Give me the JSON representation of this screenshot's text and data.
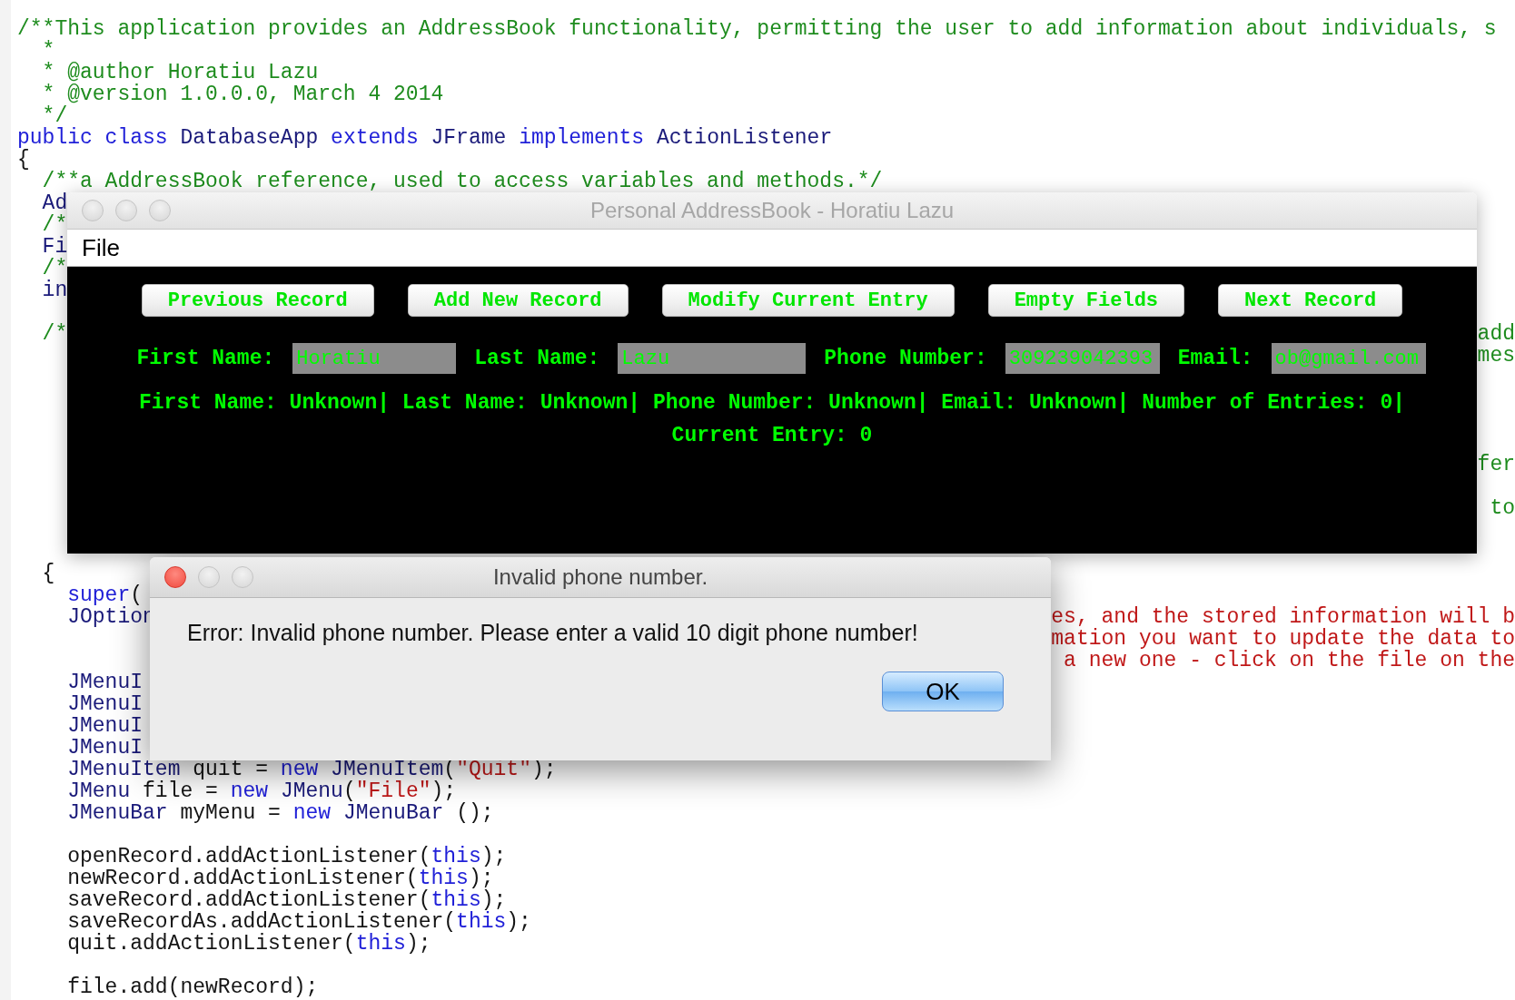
{
  "editor": {
    "lines": [
      {
        "left": [
          {
            "kind": "comment",
            "text": "/**This application provides an AddressBook functionality, permitting the user to add information about individuals, s"
          }
        ]
      },
      {
        "left": [
          {
            "kind": "comment",
            "text": "  *"
          }
        ]
      },
      {
        "left": [
          {
            "kind": "comment",
            "text": "  * @author Horatiu Lazu"
          }
        ]
      },
      {
        "left": [
          {
            "kind": "comment",
            "text": "  * @version 1.0.0.0, March 4 2014"
          }
        ]
      },
      {
        "left": [
          {
            "kind": "comment",
            "text": "  */"
          }
        ]
      },
      {
        "left": [
          {
            "kind": "keyword",
            "text": "public class "
          },
          {
            "kind": "type",
            "text": "DatabaseApp "
          },
          {
            "kind": "keyword",
            "text": "extends "
          },
          {
            "kind": "type",
            "text": "JFrame "
          },
          {
            "kind": "keyword",
            "text": "implements "
          },
          {
            "kind": "type",
            "text": "ActionListener"
          }
        ]
      },
      {
        "left": [
          {
            "kind": "plain",
            "text": "{"
          }
        ]
      },
      {
        "left": [
          {
            "kind": "comment",
            "text": "  /**a AddressBook reference, used to access variables and methods.*/"
          }
        ]
      },
      {
        "left": [
          {
            "kind": "type",
            "text": "  Ad"
          }
        ]
      },
      {
        "left": [
          {
            "kind": "comment",
            "text": "  /*"
          }
        ]
      },
      {
        "left": [
          {
            "kind": "type",
            "text": "  Fi"
          }
        ]
      },
      {
        "left": [
          {
            "kind": "comment",
            "text": "  /*"
          }
        ]
      },
      {
        "left": [
          {
            "kind": "type",
            "text": "  in"
          }
        ]
      },
      {
        "kind": "blank"
      },
      {
        "left": [
          {
            "kind": "comment",
            "text": "  /*"
          }
        ],
        "right": [
          {
            "kind": "comment",
            "text": "add"
          }
        ]
      },
      {
        "right": [
          {
            "kind": "comment",
            "text": "mes"
          }
        ]
      },
      {
        "kind": "blank"
      },
      {
        "kind": "blank"
      },
      {
        "kind": "blank"
      },
      {
        "kind": "blank"
      },
      {
        "right": [
          {
            "kind": "comment",
            "text": "fer"
          }
        ]
      },
      {
        "kind": "blank"
      },
      {
        "right": [
          {
            "kind": "comment",
            "text": "to"
          }
        ]
      },
      {
        "kind": "blank"
      },
      {
        "kind": "blank"
      },
      {
        "left": [
          {
            "kind": "plain",
            "text": "  {"
          }
        ]
      },
      {
        "left": [
          {
            "kind": "keyword",
            "text": "    super"
          },
          {
            "kind": "plain",
            "text": "("
          }
        ]
      },
      {
        "left": [
          {
            "kind": "type",
            "text": "    JOption"
          }
        ],
        "right": [
          {
            "kind": "string",
            "text": "es, and the stored information will b"
          }
        ]
      },
      {
        "right": [
          {
            "kind": "string",
            "text": "mation you want to update the data to"
          }
        ]
      },
      {
        "right": [
          {
            "kind": "string",
            "text": "a new one - click on the file on the"
          }
        ]
      },
      {
        "left": [
          {
            "kind": "type",
            "text": "    JMenuI"
          }
        ]
      },
      {
        "left": [
          {
            "kind": "type",
            "text": "    JMenuI"
          }
        ]
      },
      {
        "left": [
          {
            "kind": "type",
            "text": "    JMenuI"
          }
        ]
      },
      {
        "left": [
          {
            "kind": "type",
            "text": "    JMenuI"
          }
        ]
      },
      {
        "left": [
          {
            "kind": "type",
            "text": "    JMenuItem "
          },
          {
            "kind": "plain",
            "text": "quit = "
          },
          {
            "kind": "keyword",
            "text": "new "
          },
          {
            "kind": "type",
            "text": "JMenuItem"
          },
          {
            "kind": "plain",
            "text": "("
          },
          {
            "kind": "string",
            "text": "\"Quit\""
          },
          {
            "kind": "plain",
            "text": ");"
          }
        ]
      },
      {
        "left": [
          {
            "kind": "type",
            "text": "    JMenu "
          },
          {
            "kind": "plain",
            "text": "file = "
          },
          {
            "kind": "keyword",
            "text": "new "
          },
          {
            "kind": "type",
            "text": "JMenu"
          },
          {
            "kind": "plain",
            "text": "("
          },
          {
            "kind": "string",
            "text": "\"File\""
          },
          {
            "kind": "plain",
            "text": ");"
          }
        ]
      },
      {
        "left": [
          {
            "kind": "type",
            "text": "    JMenuBar "
          },
          {
            "kind": "plain",
            "text": "myMenu = "
          },
          {
            "kind": "keyword",
            "text": "new "
          },
          {
            "kind": "type",
            "text": "JMenuBar "
          },
          {
            "kind": "plain",
            "text": "();"
          }
        ]
      },
      {
        "kind": "blank"
      },
      {
        "left": [
          {
            "kind": "plain",
            "text": "    openRecord.addActionListener("
          },
          {
            "kind": "keyword",
            "text": "this"
          },
          {
            "kind": "plain",
            "text": ");"
          }
        ]
      },
      {
        "left": [
          {
            "kind": "plain",
            "text": "    newRecord.addActionListener("
          },
          {
            "kind": "keyword",
            "text": "this"
          },
          {
            "kind": "plain",
            "text": ");"
          }
        ]
      },
      {
        "left": [
          {
            "kind": "plain",
            "text": "    saveRecord.addActionListener("
          },
          {
            "kind": "keyword",
            "text": "this"
          },
          {
            "kind": "plain",
            "text": ");"
          }
        ]
      },
      {
        "left": [
          {
            "kind": "plain",
            "text": "    saveRecordAs.addActionListener("
          },
          {
            "kind": "keyword",
            "text": "this"
          },
          {
            "kind": "plain",
            "text": ");"
          }
        ]
      },
      {
        "left": [
          {
            "kind": "plain",
            "text": "    quit.addActionListener("
          },
          {
            "kind": "keyword",
            "text": "this"
          },
          {
            "kind": "plain",
            "text": ");"
          }
        ]
      },
      {
        "kind": "blank"
      },
      {
        "left": [
          {
            "kind": "plain",
            "text": "    file.add(newRecord);"
          }
        ]
      }
    ]
  },
  "app_window": {
    "title": "Personal AddressBook - Horatiu Lazu",
    "active": false,
    "menu": [
      {
        "label": "File"
      }
    ],
    "buttons": [
      {
        "label": "Previous Record"
      },
      {
        "label": "Add New Record"
      },
      {
        "label": "Modify Current Entry"
      },
      {
        "label": "Empty Fields"
      },
      {
        "label": "Next Record"
      }
    ],
    "fields": [
      {
        "label": "First Name:",
        "value": "Horatiu"
      },
      {
        "label": "Last Name:",
        "value": "Lazu"
      },
      {
        "label": "Phone Number:",
        "value": "309239042393"
      },
      {
        "label": "Email:",
        "value": "ob@gmail.com"
      }
    ],
    "status": "First Name: Unknown| Last Name: Unknown| Phone Number: Unknown| Email: Unknown| Number of Entries: 0| Current Entry: 0"
  },
  "dialog": {
    "title": "Invalid phone number.",
    "active": true,
    "message": "Error: Invalid phone number. Please enter a valid 10 digit phone number!",
    "buttons": [
      {
        "label": "OK",
        "default": true
      }
    ]
  }
}
